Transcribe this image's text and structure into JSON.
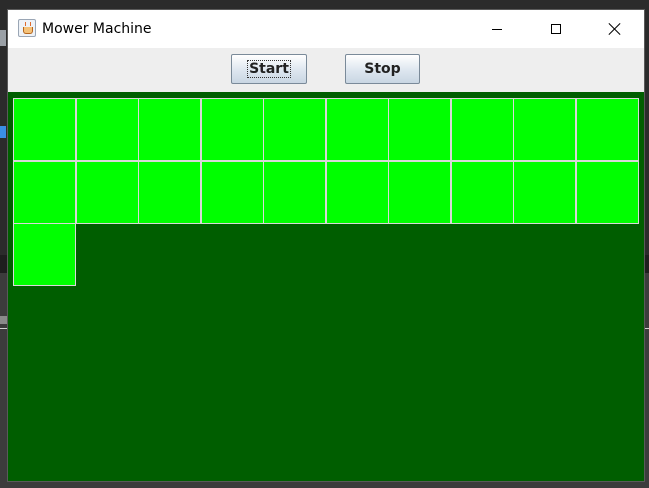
{
  "window": {
    "title": "Mower Machine",
    "icon": "java-cup-icon"
  },
  "toolbar": {
    "start_label": "Start",
    "stop_label": "Stop"
  },
  "lawn": {
    "columns": 10,
    "cut_color": "#00ff00",
    "ground_color": "#005e00",
    "grid_line_color": "#d8d8d8",
    "cut_rows": [
      [
        1,
        1,
        1,
        1,
        1,
        1,
        1,
        1,
        1,
        1
      ],
      [
        1,
        1,
        1,
        1,
        1,
        1,
        1,
        1,
        1,
        1
      ],
      [
        1,
        0,
        0,
        0,
        0,
        0,
        0,
        0,
        0,
        0
      ]
    ]
  }
}
